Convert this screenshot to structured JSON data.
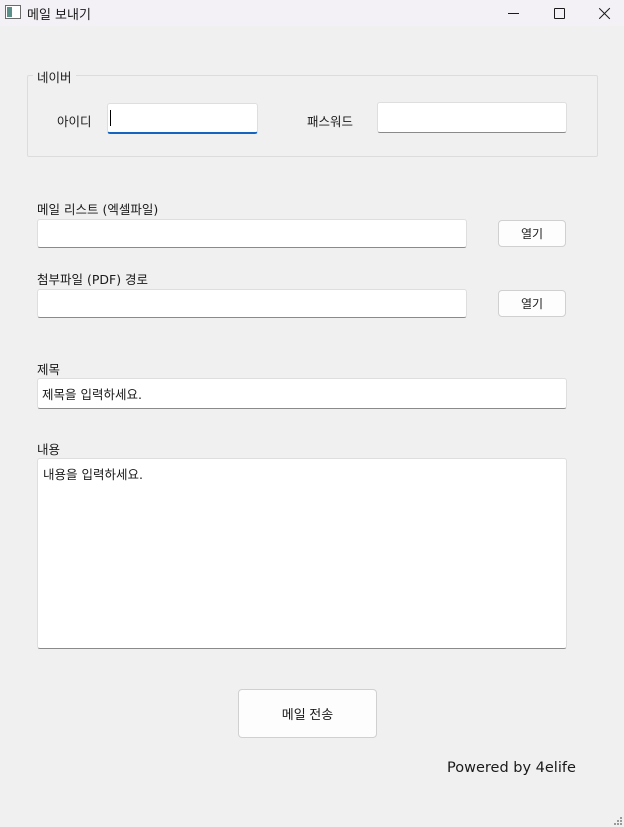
{
  "window": {
    "title": "메일 보내기",
    "controls": {
      "minimize": "minimize-icon",
      "maximize": "maximize-icon",
      "close": "close-icon"
    }
  },
  "login_group": {
    "legend": "네이버",
    "id_label": "아이디",
    "id_value": "",
    "password_label": "패스워드",
    "password_value": ""
  },
  "mail_list": {
    "label": "메일 리스트 (엑셀파일)",
    "value": "",
    "open_button": "열기"
  },
  "attachment": {
    "label": "첨부파일 (PDF) 경로",
    "value": "",
    "open_button": "열기"
  },
  "subject": {
    "label": "제목",
    "value": "제목을 입력하세요."
  },
  "content": {
    "label": "내용",
    "value": "내용을 입력하세요."
  },
  "send_button": "메일 전송",
  "footer": "Powered by 4elife",
  "colors": {
    "focus_accent": "#1565c0",
    "background": "#f0f0f0"
  }
}
